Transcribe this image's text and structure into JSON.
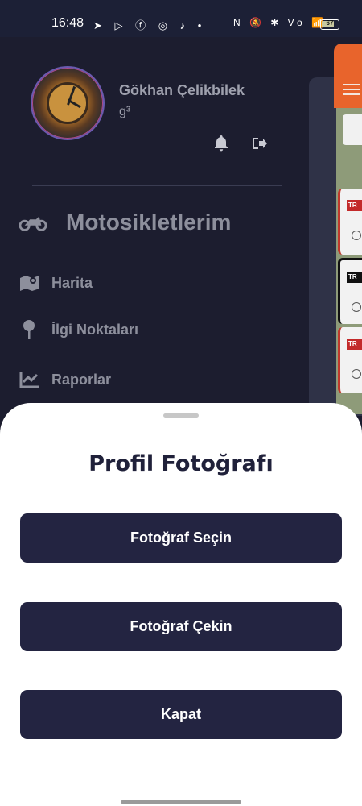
{
  "status_bar": {
    "time": "16:48",
    "left_icons": "➤ ▷ ⓕ ◎ ♪ •",
    "right_icons": "N 🔕 ✱ Vo 📶",
    "battery": "67"
  },
  "profile": {
    "name": "Gökhan Çelikbilek",
    "subtitle": "g³"
  },
  "menu": {
    "title": "Motosikletlerim",
    "items": [
      {
        "label": "Harita"
      },
      {
        "label": "İlgi Noktaları"
      },
      {
        "label": "Raporlar"
      }
    ]
  },
  "background_cards": {
    "logo_text": "TR"
  },
  "colors": {
    "drawer_bg": "#1c1d2f",
    "button_bg": "#232441",
    "accent_orange": "#e8642c"
  },
  "sheet": {
    "title": "Profil Fotoğrafı",
    "choose_label": "Fotoğraf Seçin",
    "take_label": "Fotoğraf Çekin",
    "close_label": "Kapat"
  }
}
